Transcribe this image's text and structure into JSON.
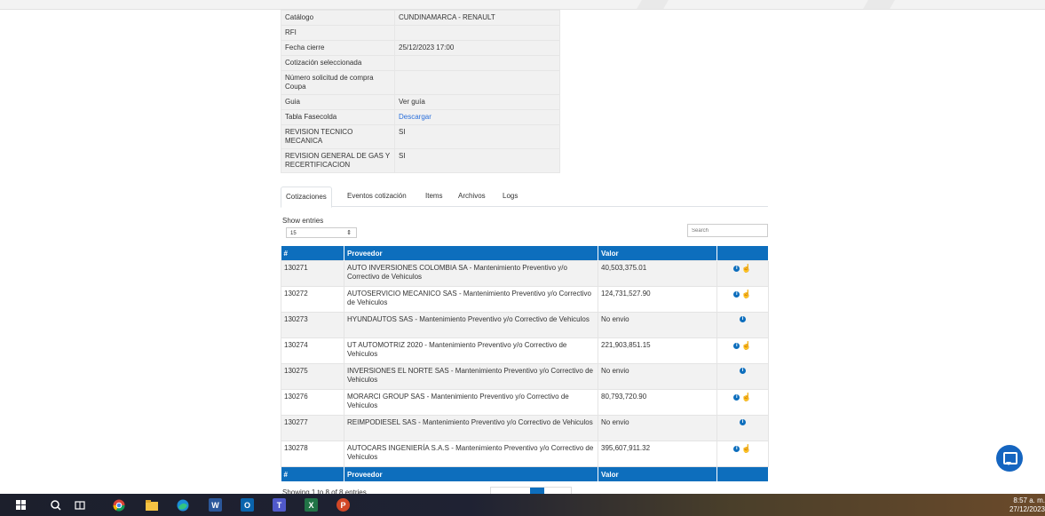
{
  "info": [
    {
      "label": "Catálogo",
      "value": "CUNDINAMARCA - RENAULT"
    },
    {
      "label": "RFI",
      "value": ""
    },
    {
      "label": "Fecha cierre",
      "value": "25/12/2023 17:00"
    },
    {
      "label": "Cotización seleccionada",
      "value": ""
    },
    {
      "label": "Número solicitud de compra Coupa",
      "value": ""
    },
    {
      "label": "Guia",
      "value": "Ver guía"
    },
    {
      "label": "Tabla Fasecolda",
      "value": "Descargar"
    },
    {
      "label": "REVISION TECNICO MECANICA",
      "value": "SI"
    },
    {
      "label": "REVISION GENERAL DE GAS Y RECERTIFICACION",
      "value": "SI"
    }
  ],
  "tabs": [
    "Cotizaciones",
    "Eventos cotización",
    "Items",
    "Archivos",
    "Logs"
  ],
  "table": {
    "show_entries": "Show entries",
    "length_value": "15",
    "search_placeholder": "Search",
    "headers": [
      "#",
      "Proveedor",
      "Valor",
      ""
    ],
    "rows": [
      {
        "id": "130271",
        "proveedor": "AUTO INVERSIONES COLOMBIA SA - Mantenimiento Preventivo y/o Correctivo de Vehiculos",
        "valor": "40,503,375.01",
        "hand": true
      },
      {
        "id": "130272",
        "proveedor": "AUTOSERVICIO MECANICO SAS - Mantenimiento Preventivo y/o Correctivo de Vehiculos",
        "valor": "124,731,527.90",
        "hand": true
      },
      {
        "id": "130273",
        "proveedor": "HYUNDAUTOS SAS - Mantenimiento Preventivo y/o Correctivo de Vehiculos",
        "valor": "No envio",
        "hand": false
      },
      {
        "id": "130274",
        "proveedor": "UT AUTOMOTRIZ 2020 - Mantenimiento Preventivo y/o Correctivo de Vehiculos",
        "valor": "221,903,851.15",
        "hand": true
      },
      {
        "id": "130275",
        "proveedor": "INVERSIONES EL NORTE SAS - Mantenimiento Preventivo y/o Correctivo de Vehiculos",
        "valor": "No envio",
        "hand": false
      },
      {
        "id": "130276",
        "proveedor": "MORARCI GROUP SAS - Mantenimiento Preventivo y/o Correctivo de Vehiculos",
        "valor": "80,793,720.90",
        "hand": true
      },
      {
        "id": "130277",
        "proveedor": "REIMPODIESEL SAS - Mantenimiento Preventivo y/o Correctivo de Vehiculos",
        "valor": "No envio",
        "hand": false
      },
      {
        "id": "130278",
        "proveedor": "AUTOCARS INGENIERÍA S.A.S - Mantenimiento Preventivo y/o Correctivo de Vehiculos",
        "valor": "395,607,911.32",
        "hand": true
      }
    ],
    "showing": "Showing 1 to 8 of 8 entries"
  },
  "taskbar": {
    "time": "8:57 a. m.",
    "date": "27/12/2023"
  },
  "colors": {
    "primary": "#0d6ebd",
    "hand": "#1f8c2a"
  }
}
